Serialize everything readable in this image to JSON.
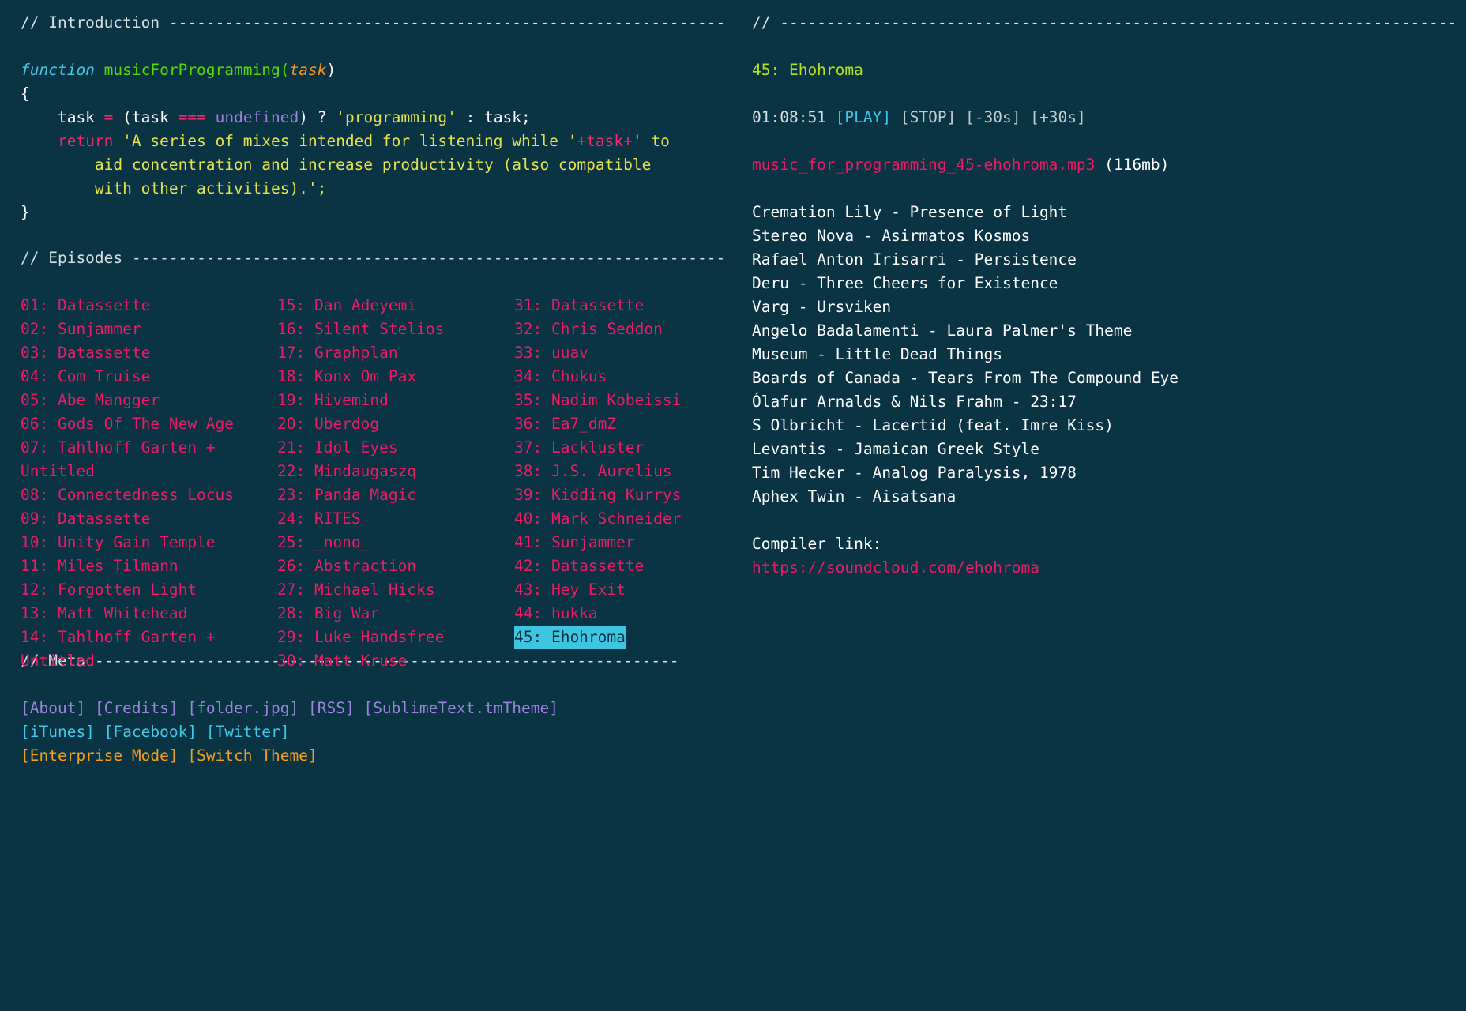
{
  "theme": {
    "background": "#0a3343",
    "comment": "#d7dfe2",
    "episode_pink": "#ec1c66",
    "selected_bg": "#3ec6e0",
    "accent_cyan": "#3fc9e8",
    "accent_green": "#b5e11e",
    "accent_purple": "#9a82dd",
    "accent_orange": "#f2a01e",
    "string_yellow": "#e6e24a"
  },
  "sections": {
    "introduction": {
      "label": "// Introduction ",
      "dashes": "------------------------------------------------------------"
    },
    "episodes": {
      "label": "// Episodes ",
      "dashes": "----------------------------------------------------------------"
    },
    "meta": {
      "label": "// Meta ",
      "dashes": "---------------------------------------------------------------"
    },
    "right": {
      "label": "// ",
      "dashes": "---------------------------------------------------------------------------------------"
    }
  },
  "code": {
    "l1_kw": "function",
    "l1_name": " musicForProgramming(",
    "l1_param": "task",
    "l1_close": ")",
    "l2": "{",
    "l3_a": "    task ",
    "l3_eq": "=",
    "l3_b": " (task ",
    "l3_eqeq": "===",
    "l3_c": " ",
    "l3_undef": "undefined",
    "l3_d": ") ? ",
    "l3_str": "'programming'",
    "l3_e": " : task;",
    "l4_indent": "    ",
    "l4_return": "return",
    "l4_sp": " ",
    "l4_str1": "'A series of mixes intended for listening while '",
    "l4_plus1": "+",
    "l4_task": "task",
    "l4_plus2": "+",
    "l4_str2": "' to",
    "l5_str": "        aid concentration and increase productivity (also compatible",
    "l6_str": "        with other activities).';",
    "l7": "}"
  },
  "episode_columns": [
    {
      "items": [
        {
          "text": "01: Datassette",
          "selected": false
        },
        {
          "text": "02: Sunjammer",
          "selected": false
        },
        {
          "text": "03: Datassette",
          "selected": false
        },
        {
          "text": "04: Com Truise",
          "selected": false
        },
        {
          "text": "05: Abe Mangger",
          "selected": false
        },
        {
          "text": "06: Gods Of The New Age",
          "selected": false
        },
        {
          "text": "07: Tahlhoff Garten + Untitled",
          "selected": false
        },
        {
          "text": "08: Connectedness Locus",
          "selected": false
        },
        {
          "text": "09: Datassette",
          "selected": false
        },
        {
          "text": "10: Unity Gain Temple",
          "selected": false
        },
        {
          "text": "11: Miles Tilmann",
          "selected": false
        },
        {
          "text": "12: Forgotten Light",
          "selected": false
        },
        {
          "text": "13: Matt Whitehead",
          "selected": false
        },
        {
          "text": "14: Tahlhoff Garten + Untitled",
          "selected": false
        }
      ]
    },
    {
      "items": [
        {
          "text": "15: Dan Adeyemi",
          "selected": false
        },
        {
          "text": "16: Silent Stelios",
          "selected": false
        },
        {
          "text": "17: Graphplan",
          "selected": false
        },
        {
          "text": "18: Konx Om Pax",
          "selected": false
        },
        {
          "text": "19: Hivemind",
          "selected": false
        },
        {
          "text": "20: Uberdog",
          "selected": false
        },
        {
          "text": "21: Idol Eyes",
          "selected": false
        },
        {
          "text": "22: Mindaugaszq",
          "selected": false
        },
        {
          "text": "23: Panda Magic",
          "selected": false
        },
        {
          "text": "24: RITES",
          "selected": false
        },
        {
          "text": "25: _nono_",
          "selected": false
        },
        {
          "text": "26: Abstraction",
          "selected": false
        },
        {
          "text": "27: Michael Hicks",
          "selected": false
        },
        {
          "text": "28: Big War",
          "selected": false
        },
        {
          "text": "29: Luke Handsfree",
          "selected": false
        },
        {
          "text": "30: Matt Kruse",
          "selected": false
        }
      ]
    },
    {
      "items": [
        {
          "text": "31: Datassette",
          "selected": false
        },
        {
          "text": "32: Chris Seddon",
          "selected": false
        },
        {
          "text": "33: uuav",
          "selected": false
        },
        {
          "text": "34: Chukus",
          "selected": false
        },
        {
          "text": "35: Nadim Kobeissi",
          "selected": false
        },
        {
          "text": "36: Ea7_dmZ",
          "selected": false
        },
        {
          "text": "37: Lackluster",
          "selected": false
        },
        {
          "text": "38: J.S. Aurelius",
          "selected": false
        },
        {
          "text": "39: Kidding Kurrys",
          "selected": false
        },
        {
          "text": "40: Mark Schneider",
          "selected": false
        },
        {
          "text": "41: Sunjammer",
          "selected": false
        },
        {
          "text": "42: Datassette",
          "selected": false
        },
        {
          "text": "43: Hey Exit",
          "selected": false
        },
        {
          "text": "44: hukka",
          "selected": false
        },
        {
          "text": "45: Ehohroma",
          "selected": true
        }
      ]
    }
  ],
  "meta_links": [
    {
      "label": "[About]",
      "color": "purple"
    },
    {
      "label": "[Credits]",
      "color": "purple"
    },
    {
      "label": "[folder.jpg]",
      "color": "purple"
    },
    {
      "label": "[RSS]",
      "color": "purple"
    },
    {
      "label": "[SublimeText.tmTheme]",
      "color": "purple"
    },
    {
      "label": "[iTunes]",
      "color": "cyan"
    },
    {
      "label": "[Facebook]",
      "color": "cyan"
    },
    {
      "label": "[Twitter]",
      "color": "cyan"
    },
    {
      "label": "[Enterprise Mode]",
      "color": "orange"
    },
    {
      "label": "[Switch Theme]",
      "color": "orange"
    }
  ],
  "player": {
    "episode_title": "45: Ehohroma",
    "time": "01:08:51",
    "play_label": "[PLAY]",
    "stop_label": "[STOP]",
    "back30_label": "[-30s]",
    "forward30_label": "[+30s]",
    "file_name": "music_for_programming_45-ehohroma.mp3",
    "file_size": "(116mb)"
  },
  "tracklist": [
    "Cremation Lily - Presence of Light",
    "Stereo Nova - Asirmatos Kosmos",
    "Rafael Anton Irisarri - Persistence",
    "Deru - Three Cheers for Existence",
    "Varg - Ursviken",
    "Angelo Badalamenti - Laura Palmer's Theme",
    "Museum - Little Dead Things",
    "Boards of Canada - Tears From The Compound Eye",
    "Ólafur Arnalds & Nils Frahm - 23:17",
    "S Olbricht - Lacertid (feat. Imre Kiss)",
    "Levantis - Jamaican Greek Style",
    "Tim Hecker - Analog Paralysis, 1978",
    "Aphex Twin - Aisatsana"
  ],
  "compiler": {
    "label": "Compiler link:",
    "url": "https://soundcloud.com/ehohroma"
  }
}
